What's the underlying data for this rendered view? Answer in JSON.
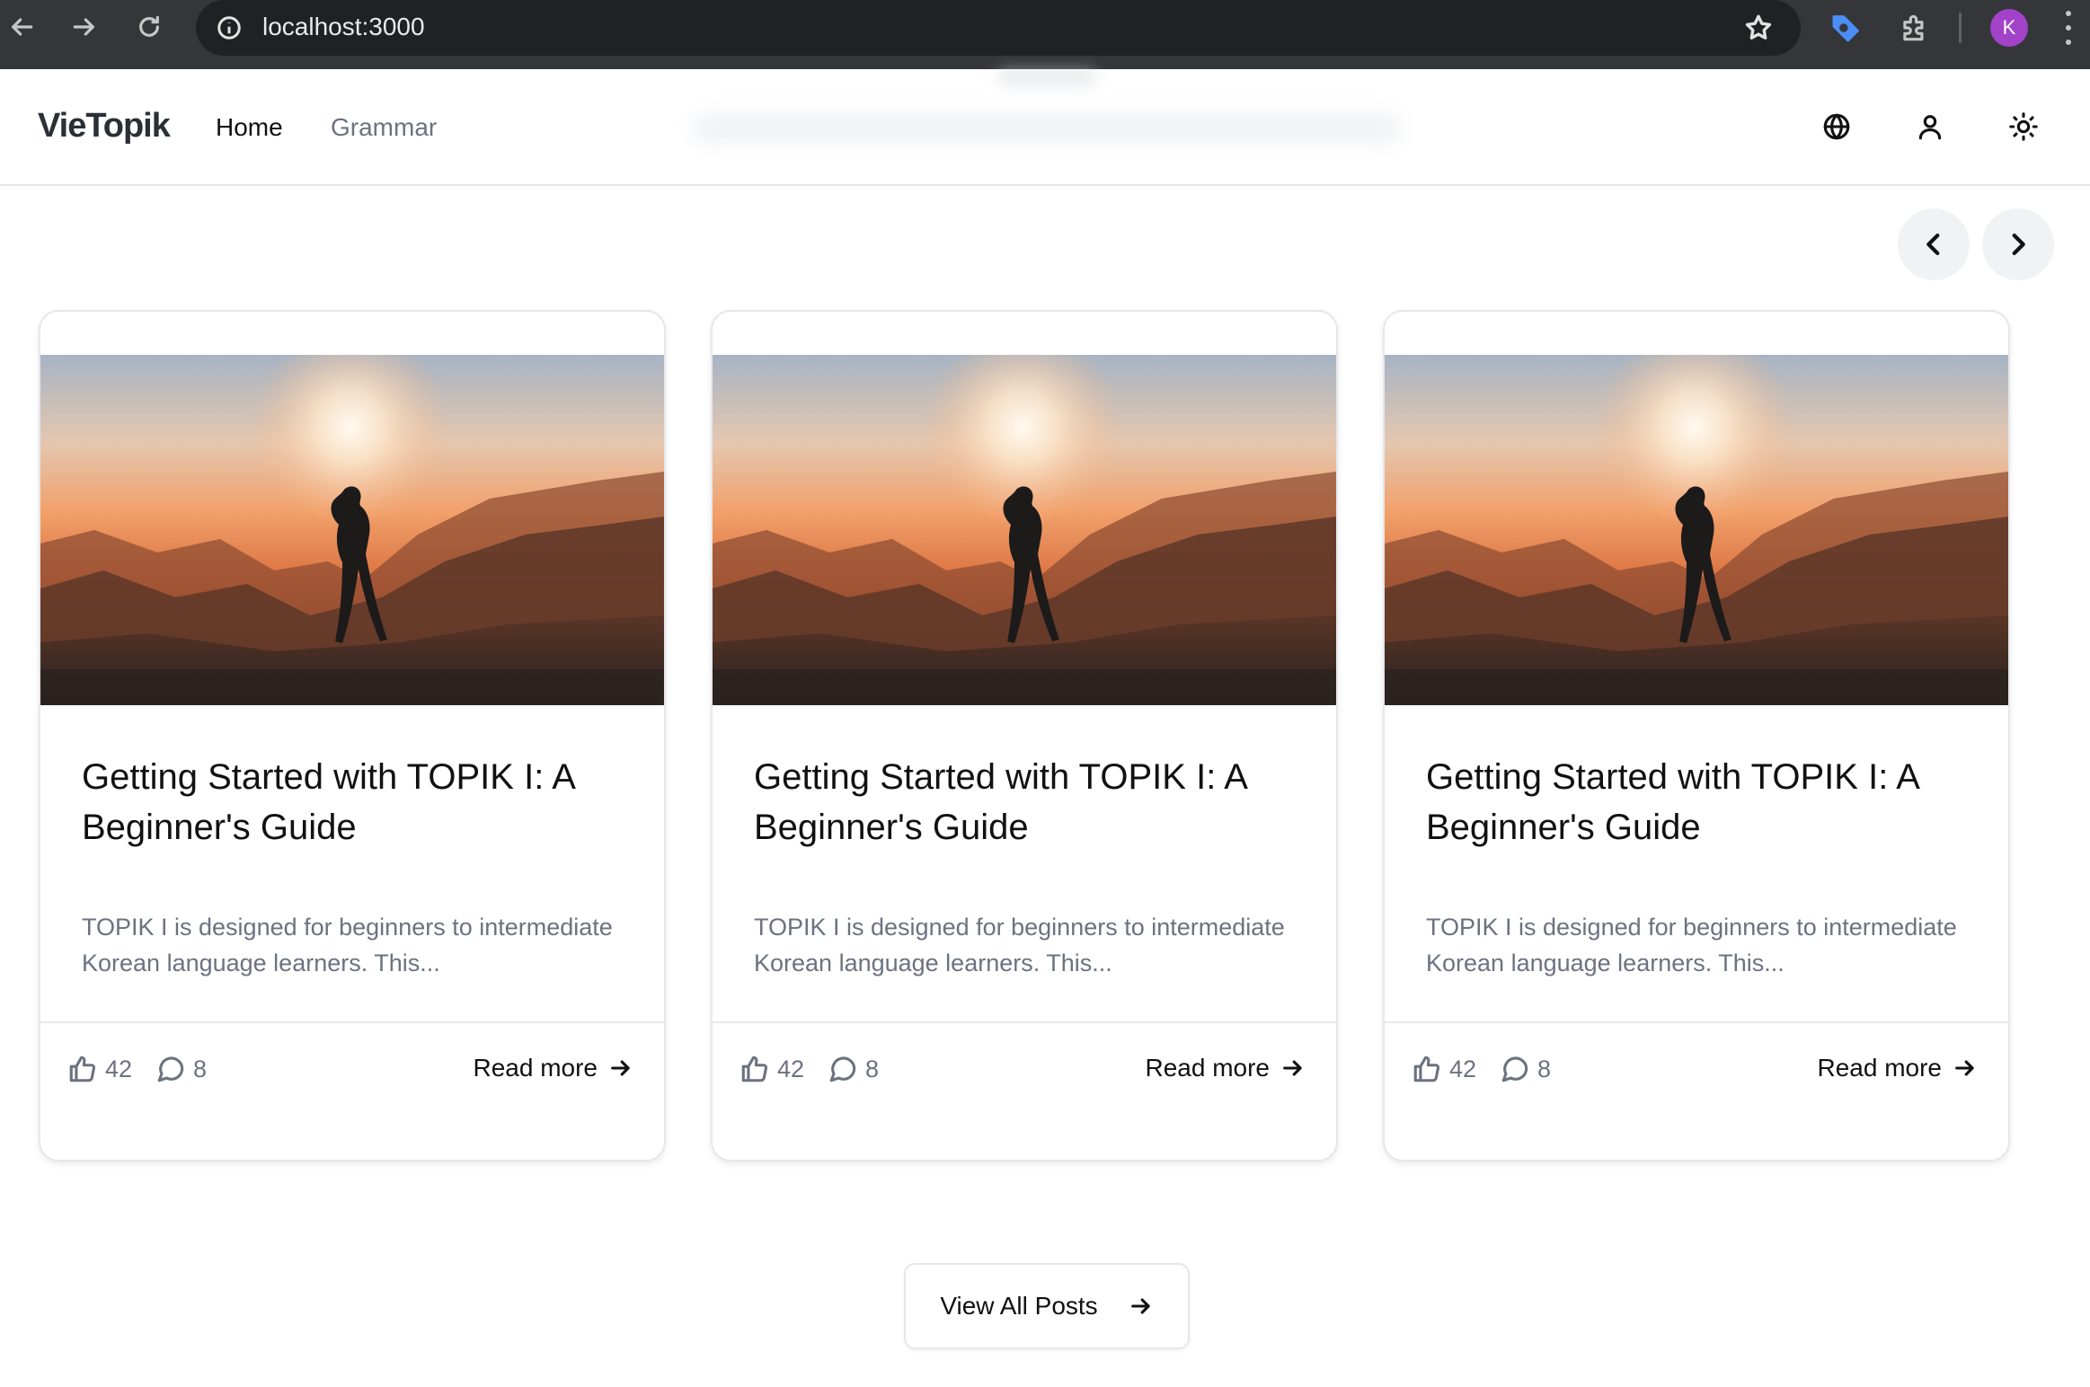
{
  "browser": {
    "url": "localhost:3000",
    "profile_initial": "K",
    "profile_color": "#a142c9"
  },
  "site": {
    "logo": "VieTopik",
    "nav": [
      {
        "label": "Home"
      },
      {
        "label": "Grammar"
      }
    ],
    "header_icons": [
      "globe-icon",
      "user-icon",
      "sun-icon"
    ]
  },
  "carousel": {
    "prev_icon": "chevron-left-icon",
    "next_icon": "chevron-right-icon"
  },
  "posts": [
    {
      "title": "Getting Started with TOPIK I: A Beginner's Guide",
      "excerpt": "TOPIK I is designed for beginners to intermediate Korean language learners. This...",
      "likes": "42",
      "comments": "8",
      "read_more": "Read more"
    },
    {
      "title": "Getting Started with TOPIK I: A Beginner's Guide",
      "excerpt": "TOPIK I is designed for beginners to intermediate Korean language learners. This...",
      "likes": "42",
      "comments": "8",
      "read_more": "Read more"
    },
    {
      "title": "Getting Started with TOPIK I: A Beginner's Guide",
      "excerpt": "TOPIK I is designed for beginners to intermediate Korean language learners. This...",
      "likes": "42",
      "comments": "8",
      "read_more": "Read more"
    }
  ],
  "view_all_label": "View All Posts"
}
